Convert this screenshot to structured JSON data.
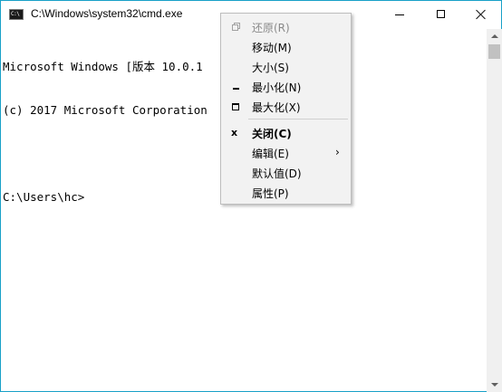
{
  "window": {
    "title": "C:\\Windows\\system32\\cmd.exe",
    "icon": "cmd-console-icon",
    "icon_text": "C:\\",
    "buttons": [
      "minimize-icon",
      "maximize-icon",
      "close-icon"
    ]
  },
  "console": {
    "lines": [
      "Microsoft Windows [版本 10.0.1",
      "(c) 2017 Microsoft Corporation",
      "",
      "C:\\Users\\hc>"
    ]
  },
  "system_menu": {
    "items": [
      {
        "label": "还原(R)",
        "icon": "restore-icon",
        "enabled": false
      },
      {
        "label": "移动(M)",
        "icon": "",
        "enabled": true
      },
      {
        "label": "大小(S)",
        "icon": "",
        "enabled": true
      },
      {
        "label": "最小化(N)",
        "icon": "minimize-icon",
        "enabled": true
      },
      {
        "label": "最大化(X)",
        "icon": "maximize-icon",
        "enabled": true
      },
      {
        "label": "关闭(C)",
        "icon": "close-icon",
        "glyph": "x",
        "enabled": true,
        "bold": true
      },
      {
        "label": "编辑(E)",
        "icon": "",
        "enabled": true,
        "submenu_arrow": "›"
      },
      {
        "label": "默认值(D)",
        "icon": "",
        "enabled": true
      },
      {
        "label": "属性(P)",
        "icon": "",
        "enabled": true
      }
    ]
  },
  "colors": {
    "window_border": "#18a0c8",
    "menu_background": "#f2f2f2",
    "disabled_text": "#8a8a8a"
  }
}
